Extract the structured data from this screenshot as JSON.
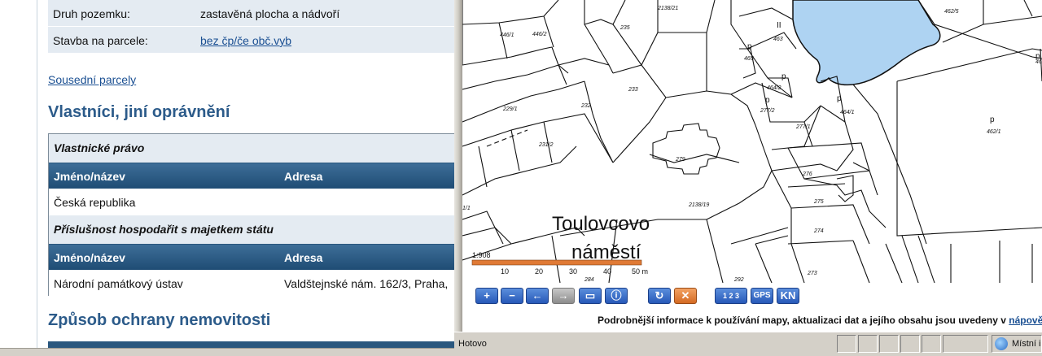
{
  "parcel": {
    "land_type_label": "Druh pozemku:",
    "land_type_value": "zastavěná plocha a nádvoří",
    "building_label": "Stavba na parcele:",
    "building_value": "bez čp/če obč.vyb"
  },
  "neighbors_link": "Sousední parcely",
  "owners_heading": "Vlastníci, jiní oprávnění",
  "owners": {
    "section1_title": "Vlastnické právo",
    "col_name": "Jméno/název",
    "col_address": "Adresa",
    "row1_name": "Česká republika",
    "row1_address": "",
    "section2_title": "Příslušnost hospodařit s majetkem státu",
    "row2_name": "Národní památkový ústav",
    "row2_address": "Valdštejnské nám. 162/3, Praha,"
  },
  "protection_heading": "Způsob ochrany nemovitosti",
  "map": {
    "street_name_1": "Toulovcovo",
    "street_name_2": "náměstí",
    "scale_ratio": "1:908",
    "scale_ticks": [
      "10",
      "20",
      "30",
      "40",
      "50 m"
    ],
    "water_color": "#aed3f2",
    "scalebar_color": "#e07a35",
    "parcel_labels": [
      "446/1",
      "446/2",
      "235",
      "2138/21",
      "463",
      "465",
      "462/5",
      "462/2",
      "229/1",
      "233",
      "232",
      "464/2",
      "277/2",
      "464/1",
      "462/1",
      "231/2",
      "279",
      "277/1",
      "276",
      "2138/19",
      "275",
      "274",
      "273",
      "II",
      "1/1",
      "292",
      "284"
    ]
  },
  "toolbar": {
    "buttons": [
      "zoom-in",
      "zoom-out",
      "pan-left",
      "pan-right",
      "zoom-rect",
      "info",
      "refresh",
      "close",
      "coordinates",
      "gps",
      "kn"
    ],
    "gps_label": "GPS",
    "kn_label": "KN",
    "coords_label": "1 2 3",
    "info_text": "Podrobnější informace k používání mapy, aktualizaci dat a jejího obsahu jsou uvedeny v",
    "info_link": "nápovědě"
  },
  "statusbar": {
    "status_text": "Hotovo",
    "zone_text": "Místní in"
  }
}
